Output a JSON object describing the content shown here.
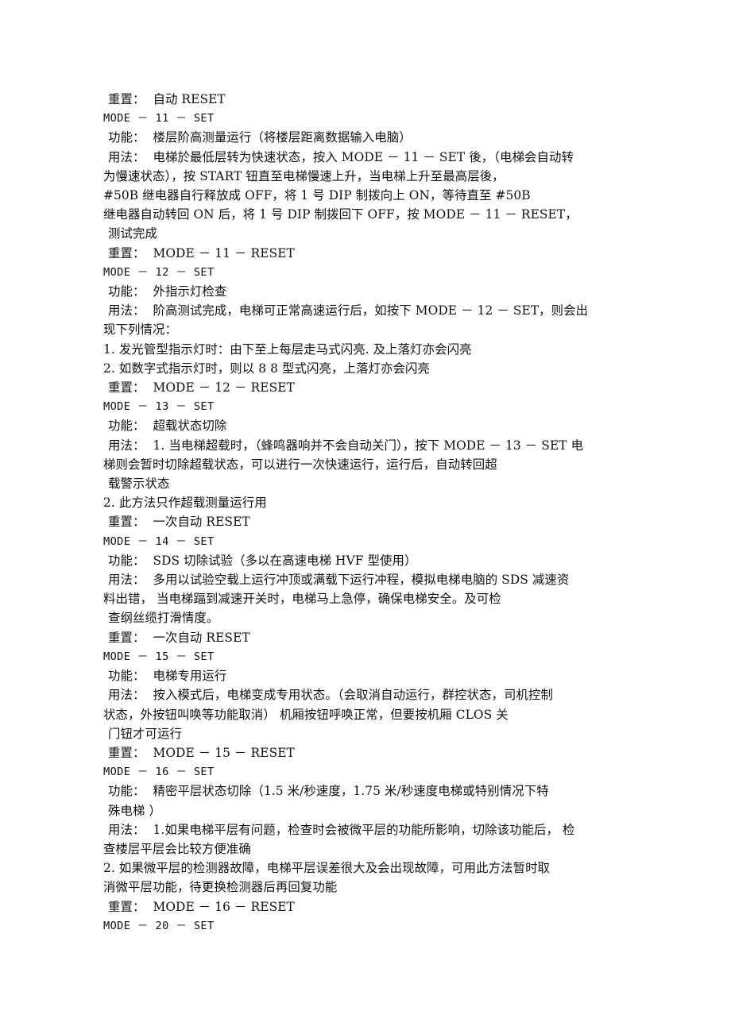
{
  "document": {
    "page_background": "#ffffff",
    "text_color": "#101010",
    "lines": [
      {
        "text": "重置：  自动 RESET",
        "style": "indent"
      },
      {
        "text": "MODE － 11 － SET",
        "style": "cmd"
      },
      {
        "text": "功能：  楼层阶高测量运行（将楼层距离数据输入电脑）",
        "style": "indent"
      },
      {
        "text": "用法：  电梯於最低层转为快速状态，按入 MODE － 11 － SET 後，（电梯会自动转",
        "style": "indent"
      },
      {
        "text": "为慢速状态），按 START 钮直至电梯慢速上升，当电梯上升至最高层後，",
        "style": "flush"
      },
      {
        "text": "#50B 继电器自行释放成 OFF，将 1 号 DIP 制拨向上 ON，等待直至 #50B",
        "style": "flush"
      },
      {
        "text": "继电器自动转回 ON 后，将 1 号 DIP 制拨回下 OFF，按 MODE － 11 － RESET，",
        "style": "flush"
      },
      {
        "text": "测试完成",
        "style": "indent"
      },
      {
        "text": "重置：  MODE － 11 － RESET",
        "style": "indent"
      },
      {
        "text": "MODE － 12 － SET",
        "style": "cmd"
      },
      {
        "text": "功能：  外指示灯检查",
        "style": "indent"
      },
      {
        "text": "用法：  阶高测试完成，电梯可正常高速运行后，如按下 MODE － 12 － SET，则会出",
        "style": "indent"
      },
      {
        "text": "现下列情况：",
        "style": "flush"
      },
      {
        "text": "1. 发光管型指示灯时：由下至上每层走马式闪亮. 及上落灯亦会闪亮",
        "style": "flush"
      },
      {
        "text": "2. 如数字式指示灯时，则以 8 8 型式闪亮，上落灯亦会闪亮",
        "style": "flush"
      },
      {
        "text": "重置：  MODE － 12 － RESET",
        "style": "indent"
      },
      {
        "text": "MODE － 13 － SET",
        "style": "cmd"
      },
      {
        "text": "功能：  超载状态切除",
        "style": "indent"
      },
      {
        "text": "用法：  1. 当电梯超载时，（蜂鸣器响并不会自动关门），按下 MODE － 13 － SET 电",
        "style": "indent"
      },
      {
        "text": "梯则会暂时切除超载状态，可以进行一次快速运行，运行后，自动转回超",
        "style": "flush"
      },
      {
        "text": "载警示状态",
        "style": "indent"
      },
      {
        "text": "2. 此方法只作超载测量运行用",
        "style": "flush"
      },
      {
        "text": "重置：  一次自动 RESET",
        "style": "indent"
      },
      {
        "text": "MODE － 14 － SET",
        "style": "cmd"
      },
      {
        "text": "功能：  SDS 切除试验（多以在高速电梯 HVF 型使用）",
        "style": "indent"
      },
      {
        "text": "用法：  多用以试验空载上运行冲顶或满载下运行冲程，模拟电梯电脑的 SDS 减速资",
        "style": "indent"
      },
      {
        "text": "料出错， 当电梯踾到减速开关时，电梯马上急停，确保电梯安全。及可检",
        "style": "flush"
      },
      {
        "text": "查纲丝缆打滑情度。",
        "style": "indent"
      },
      {
        "text": "重置：  一次自动 RESET",
        "style": "indent"
      },
      {
        "text": "MODE － 15 － SET",
        "style": "cmd"
      },
      {
        "text": "功能：  电梯专用运行",
        "style": "indent"
      },
      {
        "text": "用法：  按入模式后，电梯变成专用状态。（会取消自动运行，群控状态，司机控制",
        "style": "indent"
      },
      {
        "text": "状态，外按钮叫唤等功能取消） 机厢按钮呼唤正常，但要按机厢 CLOS 关",
        "style": "flush"
      },
      {
        "text": "门钮才可运行",
        "style": "indent"
      },
      {
        "text": "重置：  MODE － 15 － RESET",
        "style": "indent"
      },
      {
        "text": "MODE － 16 － SET",
        "style": "cmd"
      },
      {
        "text": "功能：  精密平层状态切除（1.5 米/秒速度，1.75 米/秒速度电梯或特别情况下特",
        "style": "indent"
      },
      {
        "text": "殊电梯 ）",
        "style": "indent"
      },
      {
        "text": "用法：  1.如果电梯平层有问题，检查时会被微平层的功能所影响，切除该功能后， 检",
        "style": "indent"
      },
      {
        "text": "查楼层平层会比较方便准确",
        "style": "flush"
      },
      {
        "text": "2. 如果微平层的检测器故障，电梯平层误差很大及会出现故障，可用此方法暂时取",
        "style": "flush"
      },
      {
        "text": "消微平层功能，待更换检测器后再回复功能",
        "style": "flush"
      },
      {
        "text": "重置：  MODE － 16 － RESET",
        "style": "indent"
      },
      {
        "text": "MODE － 20 － SET",
        "style": "cmd"
      }
    ]
  }
}
